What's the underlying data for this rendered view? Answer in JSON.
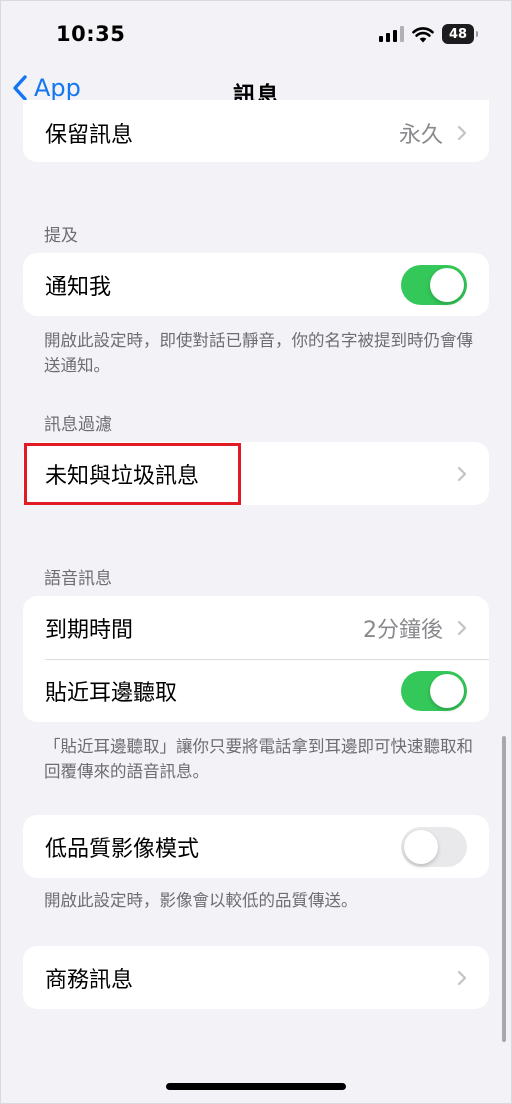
{
  "status_bar": {
    "time": "10:35",
    "battery": "48"
  },
  "nav": {
    "back_label": "App",
    "title": "訊息"
  },
  "retention": {
    "label": "保留訊息",
    "value": "永久"
  },
  "mentions": {
    "header": "提及",
    "notify_label": "通知我",
    "notify_on": true,
    "footer": "開啟此設定時，即使對話已靜音，你的名字被提到時仍會傳送通知。"
  },
  "filtering": {
    "header": "訊息過濾",
    "unknown_label": "未知與垃圾訊息"
  },
  "audio": {
    "header": "語音訊息",
    "expire_label": "到期時間",
    "expire_value": "2分鐘後",
    "raise_label": "貼近耳邊聽取",
    "raise_on": true,
    "footer": "「貼近耳邊聽取」讓你只要將電話拿到耳邊即可快速聽取和回覆傳來的語音訊息。"
  },
  "low_quality": {
    "label": "低品質影像模式",
    "on": false,
    "footer": "開啟此設定時，影像會以較低的品質傳送。"
  },
  "business": {
    "label": "商務訊息"
  },
  "colors": {
    "accent": "#1476f0",
    "toggle_on": "#34c759",
    "highlight": "#e01b24"
  }
}
